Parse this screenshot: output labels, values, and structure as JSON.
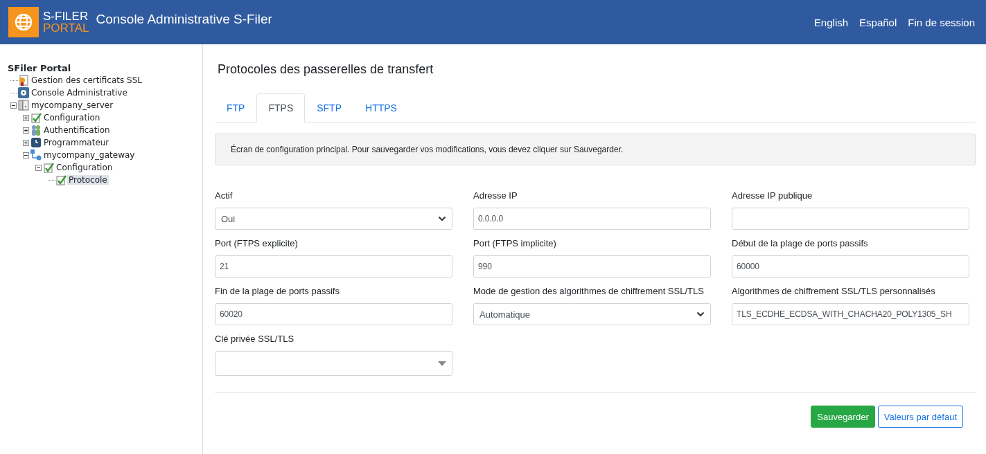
{
  "header": {
    "logo_top": "S-FILER",
    "logo_bottom": "PORTAL",
    "title": "Console Administrative S-Filer",
    "links": [
      "English",
      "Español",
      "Fin de session"
    ]
  },
  "tree": {
    "root": "SFiler Portal",
    "children": [
      {
        "label": "Gestion des certificats SSL",
        "kind": "certificate",
        "selected": false
      },
      {
        "label": "Console Administrative",
        "kind": "console",
        "selected": false
      },
      {
        "label": "mycompany_server",
        "kind": "server",
        "expanded": true,
        "selected": false,
        "children": [
          {
            "label": "Configuration",
            "kind": "config",
            "expanded": false,
            "selected": false
          },
          {
            "label": "Authentification",
            "kind": "auth",
            "expanded": false,
            "selected": false
          },
          {
            "label": "Programmateur",
            "kind": "scheduler",
            "expanded": false,
            "selected": false
          },
          {
            "label": "mycompany_gateway",
            "kind": "gateway",
            "expanded": true,
            "selected": false,
            "children": [
              {
                "label": "Configuration",
                "kind": "config",
                "expanded": true,
                "selected": false,
                "children": [
                  {
                    "label": "Protocole",
                    "kind": "config",
                    "selected": true
                  }
                ]
              }
            ]
          }
        ]
      }
    ]
  },
  "page_title": "Protocoles des passerelles de transfert",
  "tabs": [
    {
      "label": "FTP",
      "selected": false
    },
    {
      "label": "FTPS",
      "selected": true
    },
    {
      "label": "SFTP",
      "selected": false
    },
    {
      "label": "HTTPS",
      "selected": false
    }
  ],
  "notice": "Écran de configuration principal. Pour sauvegarder vos modifications, vous devez cliquer sur Sauvegarder.",
  "fields": [
    {
      "label": "Actif",
      "kind": "select",
      "value": "Oui"
    },
    {
      "label": "Adresse IP",
      "kind": "input",
      "value": "0.0.0.0"
    },
    {
      "label": "Adresse IP publique",
      "kind": "input"
    },
    {
      "label": "Port (FTPS explicite)",
      "kind": "input",
      "value": "21"
    },
    {
      "label": "Port (FTPS implicite)",
      "kind": "input",
      "value": "990"
    },
    {
      "label": "Début de la plage de ports passifs",
      "kind": "input",
      "value": "60000"
    },
    {
      "label": "Fin de la plage de ports passifs",
      "kind": "input",
      "value": "60020"
    },
    {
      "label": "Mode de gestion des algorithmes de chiffrement SSL/TLS",
      "kind": "select",
      "value": "Automatique"
    },
    {
      "label": "Algorithmes de chiffrement SSL/TLS personnalisés",
      "kind": "input",
      "value": "TLS_ECDHE_ECDSA_WITH_CHACHA20_POLY1305_SH"
    },
    {
      "label": "Clé privée SSL/TLS",
      "kind": "combo"
    }
  ],
  "buttons": [
    {
      "label": "Sauvegarder",
      "kind": "primary"
    },
    {
      "label": "Valeurs par défaut",
      "kind": "outline"
    }
  ]
}
